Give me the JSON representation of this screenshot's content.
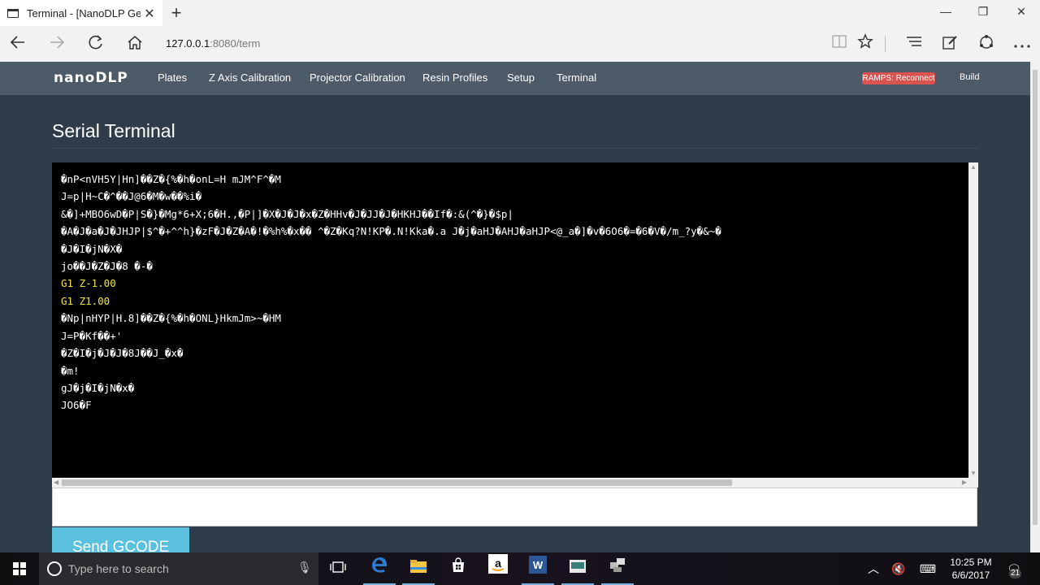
{
  "browser": {
    "tab_title": "Terminal - [NanoDLP Ge",
    "tab_close": "✕",
    "new_tab": "+",
    "url_host": "127.0.0.1",
    "url_rest": ":8080/term",
    "icons": {
      "back": "back-arrow-icon",
      "forward": "forward-arrow-icon",
      "refresh": "refresh-icon",
      "home": "home-icon",
      "reading_view": "reading-view-icon",
      "favorite": "star-icon",
      "hub": "hub-icon",
      "notes": "web-note-icon",
      "share": "share-icon",
      "more": "more-icon"
    }
  },
  "window": {
    "minimize": "—",
    "restore": "❐",
    "close": "✕"
  },
  "app": {
    "logo": "nanoDLP",
    "nav": [
      "Plates",
      "Z Axis Calibration",
      "Projector Calibration",
      "Resin Profiles",
      "Setup",
      "Terminal"
    ],
    "status_badge": "RAMPS: Reconnect",
    "build_label": "Build",
    "page_title": "Serial Terminal",
    "send_button": "Send GCODE",
    "colors": {
      "nav_bg": "#4d5a67",
      "page_bg": "#2f3d4b",
      "badge": "#d9534f",
      "send_button": "#5bc0de",
      "command_text": "#f0e632"
    }
  },
  "terminal": {
    "lines": [
      {
        "text": "�nP<nVH5Y|Hn]��Z�{%�h�onL=H mJM^F^�M",
        "kind": "output"
      },
      {
        "text": "J=p|H~C�^��J@6�M�w��%i�",
        "kind": "output"
      },
      {
        "text": "&�]+MBO6wD�P|S�}�Mg*6+X;6�H.,�P|]�X�J�J�x�Z�HHv�J�JJ�J�HKHJ��If�:&(^�}�$p|",
        "kind": "output"
      },
      {
        "text": "�A�J�a�J�JHJP|$^�+^^h}�zF�J�Z�A�!�%h%�x�� ^�Z�Kq?N!KP�.N!Kka�.a J�j�aHJ�AHJ�aHJP<@_a�]�v�6O6�=�6�V�/m_?y�&~�",
        "kind": "output"
      },
      {
        "text": "�J�I�jN�X�",
        "kind": "output"
      },
      {
        "text": "jo��J�Z�J�8 �-�",
        "kind": "output"
      },
      {
        "text": "G1 Z-1.00",
        "kind": "cmd"
      },
      {
        "text": "G1 Z1.00",
        "kind": "cmd"
      },
      {
        "text": "�Np|nHYP|H.8]��Z�{%�h�ONL}HkmJm>~�HM",
        "kind": "output"
      },
      {
        "text": "J=P�Kf��+'",
        "kind": "output"
      },
      {
        "text": "�Z�I�j�J�J�8J��J_�x�",
        "kind": "output"
      },
      {
        "text": "�m!",
        "kind": "output"
      },
      {
        "text": "gJ�j�I�jN�x�",
        "kind": "output"
      },
      {
        "text": "JO6�F",
        "kind": "output"
      }
    ]
  },
  "taskbar": {
    "search_placeholder": "Type here to search",
    "time": "10:25 PM",
    "date": "6/6/2017",
    "notifications": "21",
    "apps": [
      "task-view-icon",
      "edge-icon",
      "file-explorer-icon",
      "store-icon",
      "amazon-icon",
      "word-icon",
      "app-icon",
      "network-app-icon"
    ]
  }
}
